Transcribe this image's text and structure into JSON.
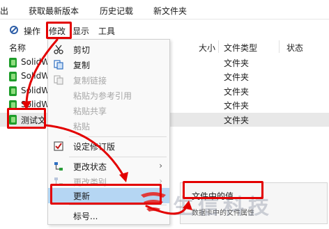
{
  "tabs": [
    "出",
    "获取最新版本",
    "历史记载",
    "新文件夹"
  ],
  "menubar": {
    "operate": "操作",
    "modify": "修改",
    "display": "显示",
    "tools": "工具"
  },
  "columns": {
    "name": "名称",
    "size": "大小",
    "type": "文件类型",
    "status": "状态"
  },
  "rows": [
    {
      "name": "SolidW",
      "type": "文件夹"
    },
    {
      "name": "SolidW",
      "type": "文件夹"
    },
    {
      "name": "SolidW",
      "type": "文件夹"
    },
    {
      "name": "SolidW",
      "type": "文件夹"
    },
    {
      "name": "测试文",
      "type": "文件夹"
    }
  ],
  "context_menu": {
    "cut": "剪切",
    "copy": "复制",
    "copy_link": "复制链接",
    "paste_ref": "粘贴为参考引用",
    "paste_share": "粘贴共享",
    "paste": "粘贴",
    "set_revision": "设定修订版",
    "change_state": "更改状态",
    "change_category": "更改类别",
    "update": "更新",
    "number": "标号..."
  },
  "submenu": {
    "file_value": "文件中的值...",
    "file_attr": "数据卡中的文件属性"
  },
  "watermark": "生信科技",
  "colors": {
    "highlight": "#e30000",
    "folder": "#1e9d2a",
    "active_item": "#b5d6f3"
  }
}
